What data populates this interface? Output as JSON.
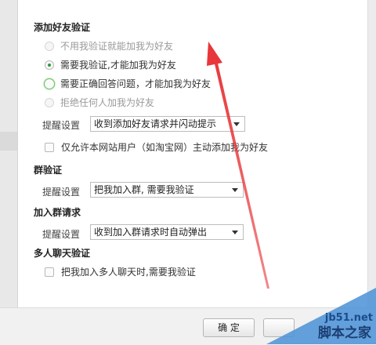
{
  "add_friend": {
    "title": "添加好友验证",
    "options": [
      {
        "label": "不用我验证就能加我为好友",
        "state": "disabled"
      },
      {
        "label": "需要我验证,才能加我为好友",
        "state": "checked"
      },
      {
        "label": "需要正确回答问题，才能加我为好友",
        "state": "focus"
      },
      {
        "label": "拒绝任何人加我为好友",
        "state": "disabled"
      }
    ],
    "reminder_label": "提醒设置",
    "reminder_value": "收到添加好友请求并闪动提示",
    "site_only_label": "仅允许本网站用户（如淘宝网）主动添加我为好友"
  },
  "group_verify": {
    "title": "群验证",
    "reminder_label": "提醒设置",
    "reminder_value": "把我加入群, 需要我验证"
  },
  "join_group": {
    "title": "加入群请求",
    "reminder_label": "提醒设置",
    "reminder_value": "收到加入群请求时自动弹出"
  },
  "multi_chat": {
    "title": "多人聊天验证",
    "option_label": "把我加入多人聊天时,需要我验证"
  },
  "footer": {
    "ok_label": "确 定"
  },
  "watermark": {
    "url": "jb51.net",
    "name": "脚本之家"
  },
  "colors": {
    "annotation_arrow": "#e8373a",
    "radio_selected": "#2a9a3e",
    "watermark_blue": "#4a90d6"
  }
}
